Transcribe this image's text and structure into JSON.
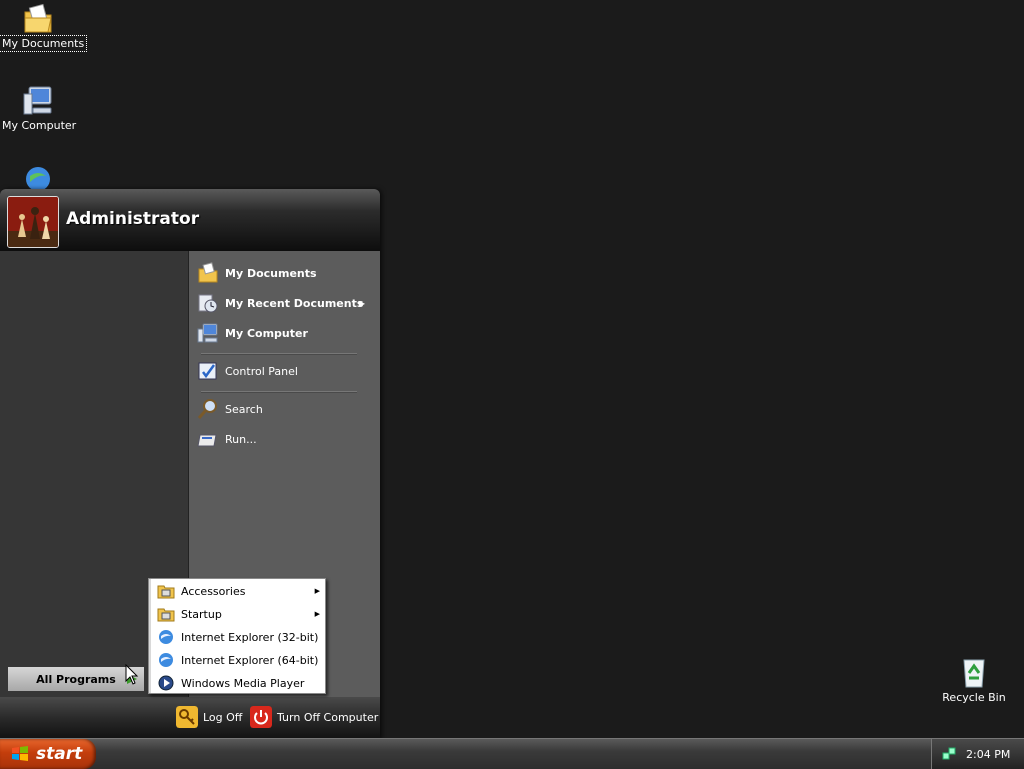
{
  "desktop": {
    "icons": [
      {
        "label": "My Documents",
        "selected": true,
        "icon": "my-documents-icon"
      },
      {
        "label": "My Computer",
        "icon": "my-computer-icon"
      },
      {
        "label": "",
        "icon": "internet-explorer-icon"
      },
      {
        "label": "Recycle Bin",
        "icon": "recycle-bin-icon"
      }
    ]
  },
  "start_menu": {
    "username": "Administrator",
    "right_items": [
      {
        "label": "My Documents",
        "icon": "my-documents-icon"
      },
      {
        "label": "My Recent Documents",
        "icon": "recent-documents-icon",
        "has_submenu": true
      },
      {
        "label": "My Computer",
        "icon": "my-computer-icon"
      },
      {
        "label": "Control Panel",
        "icon": "control-panel-icon"
      },
      {
        "label": "Search",
        "icon": "search-icon"
      },
      {
        "label": "Run...",
        "icon": "run-icon"
      }
    ],
    "all_programs": "All Programs",
    "footer": {
      "log_off": "Log Off",
      "turn_off": "Turn Off Computer"
    }
  },
  "programs_submenu": {
    "items": [
      {
        "label": "Accessories",
        "icon": "program-group-icon",
        "has_submenu": true
      },
      {
        "label": "Startup",
        "icon": "program-group-icon",
        "has_submenu": true
      },
      {
        "label": "Internet Explorer (32-bit)",
        "icon": "internet-explorer-icon"
      },
      {
        "label": "Internet Explorer (64-bit)",
        "icon": "internet-explorer-icon"
      },
      {
        "label": "Windows Media Player",
        "icon": "media-player-icon"
      }
    ]
  },
  "taskbar": {
    "start_label": "start",
    "clock": "2:04 PM",
    "colors": {
      "start_button": "#d2501a",
      "taskbar": "#3a3a3a"
    }
  }
}
